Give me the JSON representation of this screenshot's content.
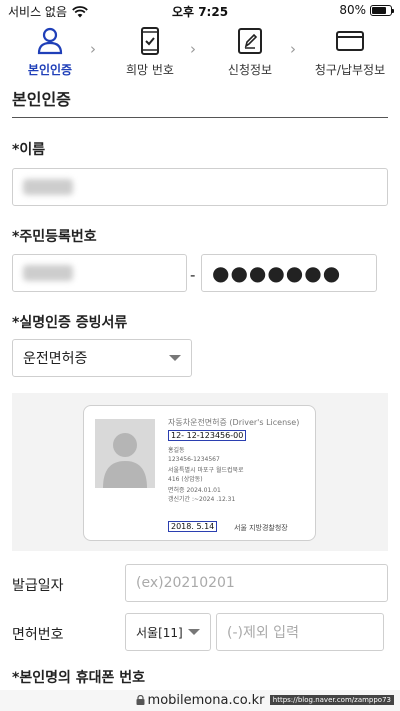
{
  "status_bar": {
    "carrier": "서비스 없음",
    "time": "오후 7:25",
    "battery": "80%",
    "battery_level": 0.8
  },
  "steps": [
    {
      "label": "본인인증",
      "icon": "person-icon",
      "active": true
    },
    {
      "label": "희망 번호",
      "icon": "phone-check-icon",
      "active": false
    },
    {
      "label": "신청정보",
      "icon": "edit-document-icon",
      "active": false
    },
    {
      "label": "청구/납부정보",
      "icon": "card-icon",
      "active": false
    }
  ],
  "section": {
    "title": "본인인증"
  },
  "fields": {
    "name_label": "*이름",
    "rrn_label": "*주민등록번호",
    "rrn_dash": "-",
    "rrn_back_masked": "●●●●●●●",
    "doc_label": "*실명인증 증빙서류",
    "doc_selected": "운전면허증",
    "phone_label": "*본인명의 휴대폰 번호"
  },
  "license_sample": {
    "title": "자동차운전면허증 (Driver's License)",
    "number": "12- 12-123456-00",
    "name": "홍길동",
    "rrn": "123456-1234567",
    "address_line1": "서울특별시 마포구 월드컵북로",
    "address_line2": "416 (상암동)",
    "renewal": "면허증 2024.01.01",
    "valid_period": "갱신기간 :~2024 .12.31",
    "issue_date": "2018. 5.14",
    "issuer": "서울 지방경찰청장"
  },
  "issue_date_row": {
    "label": "발급일자",
    "placeholder": "(ex)20210201"
  },
  "license_number_row": {
    "label": "면허번호",
    "region_selected": "서울[11]",
    "placeholder": "(-)제외 입력"
  },
  "browser": {
    "url": "mobilemona.co.kr",
    "watermark": "https://blog.naver.com/zamppo73"
  }
}
